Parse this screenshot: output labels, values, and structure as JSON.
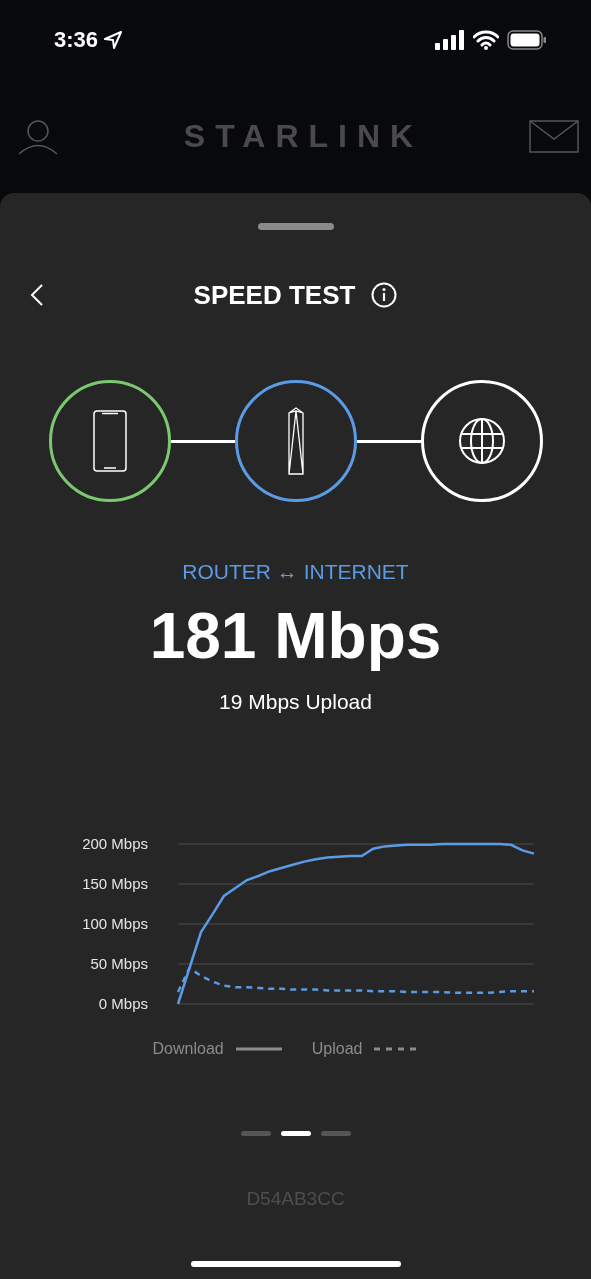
{
  "status_bar": {
    "time": "3:36"
  },
  "header": {
    "logo": "STARLINK"
  },
  "sheet": {
    "title": "SPEED TEST",
    "nodes": [
      {
        "kind": "phone",
        "color": "#7bc96f"
      },
      {
        "kind": "router",
        "color": "#5b9be6"
      },
      {
        "kind": "internet",
        "color": "#ffffff"
      }
    ],
    "route": "ROUTER ↔ INTERNET",
    "download_speed": "181 Mbps",
    "upload_speed": "19 Mbps Upload",
    "chart_data": {
      "type": "line",
      "grid": true,
      "ylim": [
        0,
        200
      ],
      "yticks": [
        {
          "value": 0,
          "label": "0 Mbps"
        },
        {
          "value": 50,
          "label": "50 Mbps"
        },
        {
          "value": 100,
          "label": "100 Mbps"
        },
        {
          "value": 150,
          "label": "150 Mbps"
        },
        {
          "value": 200,
          "label": "200 Mbps"
        }
      ],
      "series": [
        {
          "name": "Download",
          "color": "#5b9be6",
          "line_style": "solid",
          "values": [
            0,
            45,
            90,
            112,
            135,
            145,
            155,
            160,
            166,
            170,
            174,
            178,
            181,
            183,
            184,
            185,
            185,
            194,
            197,
            198,
            199,
            199,
            199,
            200,
            200,
            200,
            200,
            200,
            200,
            199,
            192,
            188
          ]
        },
        {
          "name": "Upload",
          "color": "#5b9be6",
          "line_style": "dashed",
          "values": [
            15,
            45,
            35,
            28,
            23,
            21,
            21,
            20,
            19,
            19,
            18,
            18,
            18,
            17,
            17,
            17,
            17,
            16,
            16,
            16,
            15,
            15,
            15,
            15,
            14,
            14,
            14,
            14,
            15,
            16,
            16,
            16
          ]
        }
      ]
    },
    "pages": [
      {
        "selected": false
      },
      {
        "selected": true
      },
      {
        "selected": false
      }
    ],
    "device_id": "D54AB3CC"
  }
}
